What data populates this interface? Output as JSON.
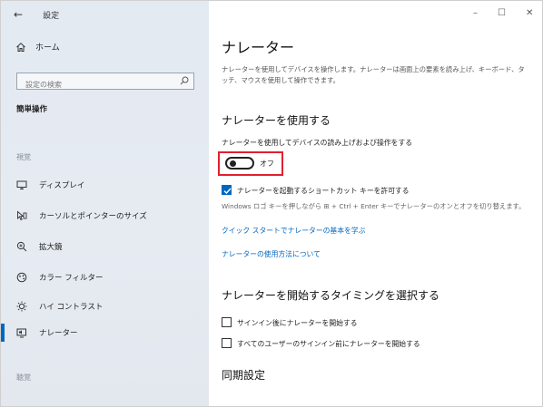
{
  "window": {
    "title": "設定",
    "controls": {
      "minimize": "–",
      "maximize": "☐",
      "close": "✕"
    }
  },
  "sidebar": {
    "back_icon": "←",
    "home_label": "ホーム",
    "search_placeholder": "設定の検索",
    "category_title": "簡単操作",
    "groups": [
      {
        "label": "視覚"
      },
      {
        "label": "聴覚"
      }
    ],
    "items": [
      {
        "label": "ディスプレイ",
        "icon": "display-icon"
      },
      {
        "label": "カーソルとポインターのサイズ",
        "icon": "cursor-icon"
      },
      {
        "label": "拡大鏡",
        "icon": "magnifier-icon"
      },
      {
        "label": "カラー フィルター",
        "icon": "color-filter-icon"
      },
      {
        "label": "ハイ コントラスト",
        "icon": "high-contrast-icon"
      },
      {
        "label": "ナレーター",
        "icon": "narrator-icon",
        "active": true
      }
    ],
    "accent_color": "#0067c0"
  },
  "main": {
    "title": "ナレーター",
    "description": "ナレーターを使用してデバイスを操作します。ナレーターは画面上の要素を読み上げ、キーボード、タッチ、マウスを使用して操作できます。",
    "use_section": {
      "title": "ナレーターを使用する",
      "toggle_label": "ナレーターを使用してデバイスの読み上げおよび操作をする",
      "toggle_state": "オフ",
      "shortcut_checkbox_label": "ナレーターを起動するショートカット キーを許可する",
      "shortcut_checked": true,
      "hint": "Windows ロゴ キーを押しながら ⊞ + Ctrl + Enter キーでナレーターのオンとオフを切り替えます。",
      "quickstart_link": "クイック スタートでナレーターの基本を学ぶ",
      "howto_link": "ナレーターの使用方法について"
    },
    "start_section": {
      "title": "ナレーターを開始するタイミングを選択する",
      "options": [
        {
          "label": "サインイン後にナレーターを開始する",
          "checked": false
        },
        {
          "label": "すべてのユーザーのサインイン前にナレーターを開始する",
          "checked": false
        }
      ]
    },
    "sync_section": {
      "title": "同期設定"
    },
    "highlight_color": "#e02030"
  }
}
